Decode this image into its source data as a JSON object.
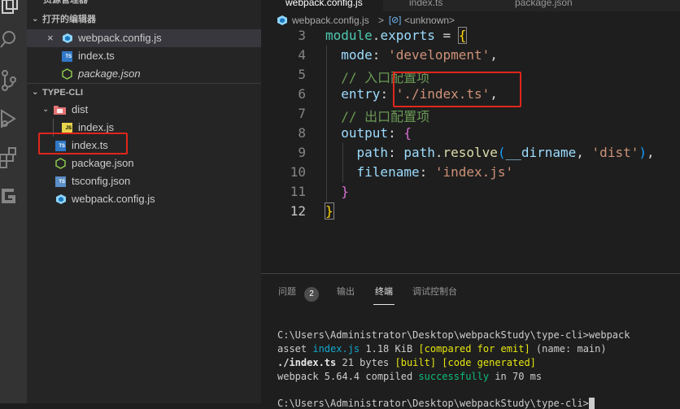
{
  "sidebar": {
    "top_partial_label": "资源管理器",
    "open_editors": {
      "header": "打开的编辑器",
      "items": [
        {
          "label": "webpack.config.js",
          "icon": "webpack-icon",
          "modified": false,
          "close": "×"
        },
        {
          "label": "index.ts",
          "icon": "ts-file-icon"
        },
        {
          "label": "package.json",
          "icon": "node-json-icon",
          "italic": true
        }
      ]
    },
    "project": {
      "header": "TYPE-CLI",
      "items": [
        {
          "label": "dist",
          "icon": "folder-dist-icon",
          "expanded": true
        },
        {
          "label": "index.js",
          "icon": "js-file-icon"
        },
        {
          "label": "index.ts",
          "icon": "ts-file-icon"
        },
        {
          "label": "package.json",
          "icon": "node-json-icon"
        },
        {
          "label": "tsconfig.json",
          "icon": "tsconfig-icon"
        },
        {
          "label": "webpack.config.js",
          "icon": "webpack-icon"
        }
      ]
    }
  },
  "tabs": [
    {
      "label": "webpack.config.js"
    },
    {
      "label": "index.ts"
    },
    {
      "label": "package.json"
    }
  ],
  "breadcrumb": {
    "file": "webpack.config.js",
    "separator": ">",
    "symbol": "<unknown>"
  },
  "editor": {
    "lines": [
      {
        "num": "3",
        "text": "module.exports = {"
      },
      {
        "num": "4",
        "text": "  mode: 'development',"
      },
      {
        "num": "5",
        "text": "  // 入口配置项"
      },
      {
        "num": "6",
        "text": "  entry: './index.ts',"
      },
      {
        "num": "7",
        "text": "  // 出口配置项"
      },
      {
        "num": "8",
        "text": "  output: {"
      },
      {
        "num": "9",
        "text": "    path: path.resolve(__dirname, 'dist'),"
      },
      {
        "num": "10",
        "text": "    filename: 'index.js'"
      },
      {
        "num": "11",
        "text": "  }"
      },
      {
        "num": "12",
        "text": "}"
      }
    ]
  },
  "panel": {
    "tabs": [
      {
        "label": "问题",
        "badge": "2"
      },
      {
        "label": "输出"
      },
      {
        "label": "终端",
        "active": true
      },
      {
        "label": "调试控制台"
      }
    ],
    "terminal": {
      "line1": "C:\\Users\\Administrator\\Desktop\\webpackStudy\\type-cli>webpack",
      "line2_a": "asset ",
      "line2_b": "index.js",
      "line2_c": " 1.18 KiB ",
      "line2_d": "[compared for emit]",
      "line2_e": " (name: main)",
      "line3_a": "./index.ts",
      "line3_b": " 21 bytes ",
      "line3_c": "[built] [code generated]",
      "line4_a": "webpack 5.64.4 compiled ",
      "line4_b": "successfully",
      "line4_c": " in 70 ms",
      "line5": "C:\\Users\\Administrator\\Desktop\\webpackStudy\\type-cli>"
    }
  },
  "colors": {
    "highlight_box": "#e0261c",
    "accent": "#007acc"
  }
}
